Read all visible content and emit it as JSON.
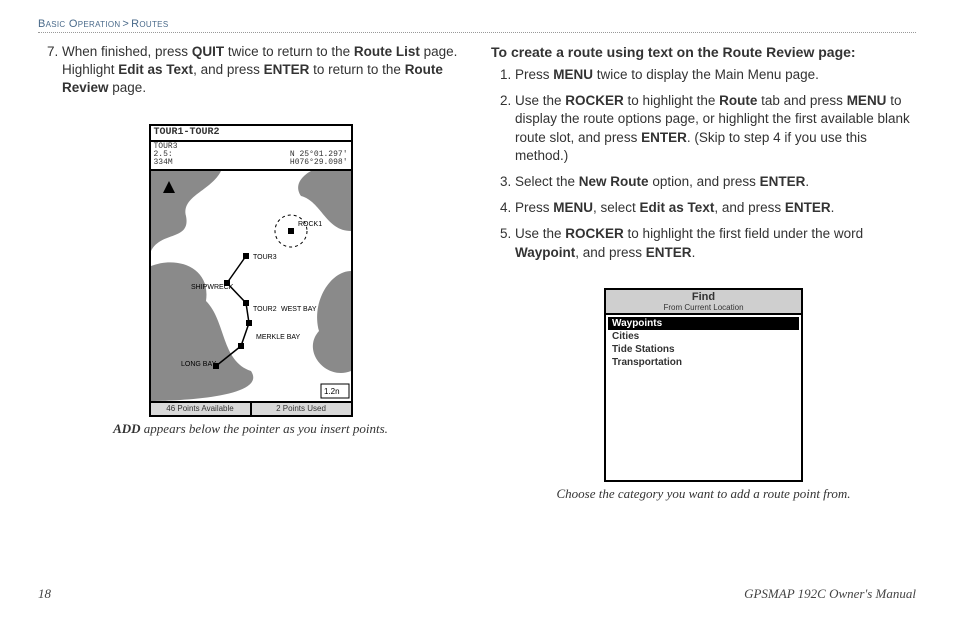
{
  "breadcrumb": {
    "a": "Basic Operation",
    "b": "Routes"
  },
  "left": {
    "step7": {
      "num": "7",
      "pre": "When finished, press ",
      "k1": "QUIT",
      "mid1": " twice to return to the ",
      "k2": "Route List",
      "mid2": " page. Highlight ",
      "k3": "Edit as Text",
      "mid3": ", and press ",
      "k4": "ENTER",
      "mid4": " to return to the ",
      "k5": "Route Review",
      "end": " page."
    },
    "device": {
      "title": "TOUR1-TOUR2",
      "sub_left1": "TOUR3",
      "sub_left2": "2.5:",
      "sub_left3": "334M",
      "sub_right1": "N 25°01.297'",
      "sub_right2": "H076°29.098'",
      "map_labels": {
        "rock1": "ROCK1",
        "tour3": "TOUR3",
        "shipwreck": "SHIPWRECK",
        "tour2": "TOUR2",
        "westbay": "WEST BAY",
        "merklebay": "MERKLE BAY",
        "longbay": "LONG BAY",
        "scale": "1.2n"
      },
      "foot_left": "46 Points Available",
      "foot_right": "2 Points Used"
    },
    "caption": {
      "b": "ADD",
      "rest": " appears below the pointer as you insert points."
    }
  },
  "right": {
    "heading": "To create a route using text on the Route Review page:",
    "steps": {
      "s1": {
        "a": "Press ",
        "k1": "MENU",
        "b": " twice to display the Main Menu page."
      },
      "s2": {
        "a": "Use the ",
        "k1": "ROCKER",
        "b": " to highlight the ",
        "k2": "Route",
        "c": " tab and press ",
        "k3": "MENU",
        "d": " to display the route options page, or highlight the first available blank route slot, and press ",
        "k4": "ENTER",
        "e": ". (Skip to step 4 if you use this method.)"
      },
      "s3": {
        "a": "Select the ",
        "k1": "New Route",
        "b": " option, and press ",
        "k2": "ENTER",
        "c": "."
      },
      "s4": {
        "a": "Press ",
        "k1": "MENU",
        "b": ", select ",
        "k2": "Edit as Text",
        "c": ", and press ",
        "k3": "ENTER",
        "d": "."
      },
      "s5": {
        "a": "Use the ",
        "k1": "ROCKER",
        "b": " to highlight the first field under the word ",
        "k2": "Waypoint",
        "c": ", and press ",
        "k3": "ENTER",
        "d": "."
      }
    },
    "device": {
      "find": "Find",
      "from": "From Current Location",
      "items": {
        "i0": "Waypoints",
        "i1": "Cities",
        "i2": "Tide Stations",
        "i3": "Transportation"
      }
    },
    "caption": "Choose the category you want to add a route point from."
  },
  "footer": {
    "page": "18",
    "manual": "GPSMAP 192C Owner's Manual"
  }
}
